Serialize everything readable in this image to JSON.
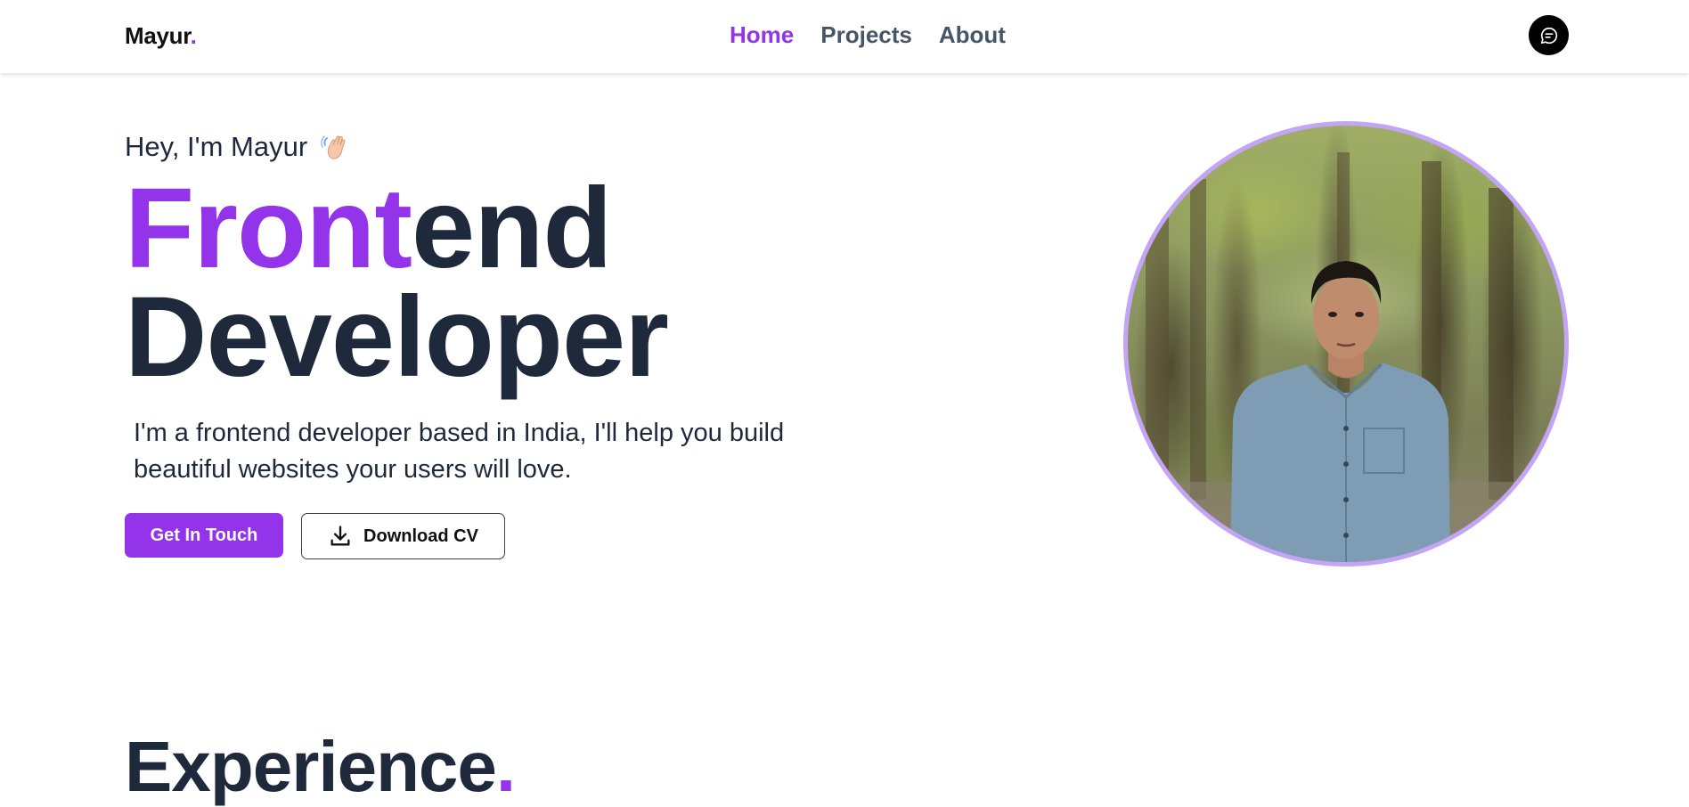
{
  "header": {
    "logo": {
      "text": "Mayur",
      "dot": "."
    },
    "nav": [
      {
        "label": "Home",
        "active": true
      },
      {
        "label": "Projects",
        "active": false
      },
      {
        "label": "About",
        "active": false
      }
    ],
    "chat_icon": "chat-bubble-icon"
  },
  "hero": {
    "greeting": "Hey, I'm Mayur",
    "greeting_icon": "waving-hand-icon",
    "headline_accent": "Front",
    "headline_rest": "end",
    "headline_line2": "Developer",
    "intro": "I'm a frontend developer based in India, I'll help you build beautiful websites your users will love.",
    "cta_primary": "Get In Touch",
    "cta_secondary": "Download CV",
    "cta_secondary_icon": "download-icon"
  },
  "experience": {
    "title": "Experience",
    "dot": "."
  },
  "colors": {
    "accent": "#9333ea",
    "text": "#1e293b",
    "portrait_ring": "#c4a5f5"
  }
}
